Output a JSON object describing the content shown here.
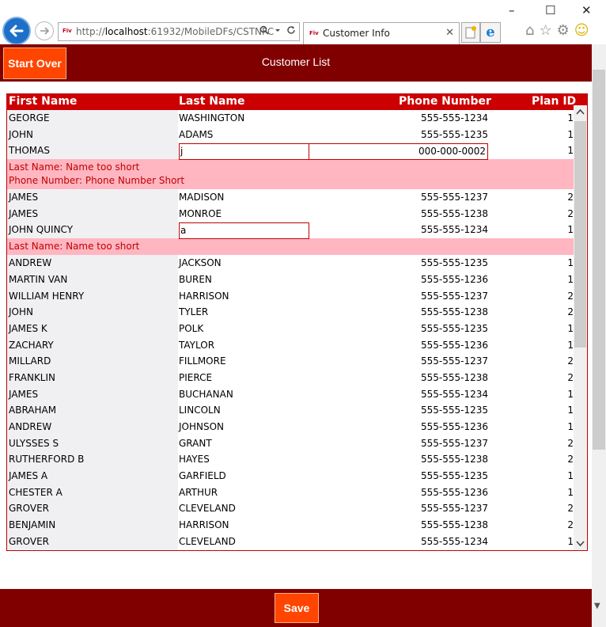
{
  "browser": {
    "address_prefix": "http://",
    "address_host": "localhost",
    "address_rest": ":61932/MobileDFs/CSTNFC",
    "tab_title": "Customer Info",
    "favicon_text": "Fiv",
    "window_controls": {
      "minimize": "–",
      "maximize": "☐",
      "close": "✕"
    },
    "tab_close": "✕"
  },
  "header": {
    "start_over_label": "Start Over",
    "title": "Customer List"
  },
  "grid": {
    "columns": {
      "first_name": "First Name",
      "last_name": "Last Name",
      "phone": "Phone Number",
      "plan": "Plan ID"
    },
    "rows": [
      {
        "first": "GEORGE",
        "last": "WASHINGTON",
        "phone": "555-555-1234",
        "plan": "1"
      },
      {
        "first": "JOHN",
        "last": "ADAMS",
        "phone": "555-555-1235",
        "plan": "1"
      },
      {
        "first": "THOMAS",
        "last": "j",
        "phone": "000-000-0002",
        "plan": "1",
        "editing": true,
        "errors": [
          "Last Name: Name too short",
          "Phone Number: Phone Number Short"
        ]
      },
      {
        "first": "JAMES",
        "last": "MADISON",
        "phone": "555-555-1237",
        "plan": "2"
      },
      {
        "first": "JAMES",
        "last": "MONROE",
        "phone": "555-555-1238",
        "plan": "2"
      },
      {
        "first": "JOHN QUINCY",
        "last": "a",
        "phone": "555-555-1234",
        "plan": "1",
        "editing_last": true,
        "errors": [
          "Last Name: Name too short"
        ]
      },
      {
        "first": "ANDREW",
        "last": "JACKSON",
        "phone": "555-555-1235",
        "plan": "1"
      },
      {
        "first": "MARTIN VAN",
        "last": "BUREN",
        "phone": "555-555-1236",
        "plan": "1"
      },
      {
        "first": "WILLIAM HENRY",
        "last": "HARRISON",
        "phone": "555-555-1237",
        "plan": "2"
      },
      {
        "first": "JOHN",
        "last": "TYLER",
        "phone": "555-555-1238",
        "plan": "2"
      },
      {
        "first": "JAMES K",
        "last": "POLK",
        "phone": "555-555-1235",
        "plan": "1"
      },
      {
        "first": "ZACHARY",
        "last": "TAYLOR",
        "phone": "555-555-1236",
        "plan": "1"
      },
      {
        "first": "MILLARD",
        "last": "FILLMORE",
        "phone": "555-555-1237",
        "plan": "2"
      },
      {
        "first": "FRANKLIN",
        "last": "PIERCE",
        "phone": "555-555-1238",
        "plan": "2"
      },
      {
        "first": "JAMES",
        "last": "BUCHANAN",
        "phone": "555-555-1234",
        "plan": "1"
      },
      {
        "first": "ABRAHAM",
        "last": "LINCOLN",
        "phone": "555-555-1235",
        "plan": "1"
      },
      {
        "first": "ANDREW",
        "last": "JOHNSON",
        "phone": "555-555-1236",
        "plan": "1"
      },
      {
        "first": "ULYSSES S",
        "last": "GRANT",
        "phone": "555-555-1237",
        "plan": "2"
      },
      {
        "first": "RUTHERFORD B",
        "last": "HAYES",
        "phone": "555-555-1238",
        "plan": "2"
      },
      {
        "first": "JAMES A",
        "last": "GARFIELD",
        "phone": "555-555-1235",
        "plan": "1"
      },
      {
        "first": "CHESTER A",
        "last": "ARTHUR",
        "phone": "555-555-1236",
        "plan": "1"
      },
      {
        "first": "GROVER",
        "last": "CLEVELAND",
        "phone": "555-555-1237",
        "plan": "2"
      },
      {
        "first": "BENJAMIN",
        "last": "HARRISON",
        "phone": "555-555-1238",
        "plan": "2"
      },
      {
        "first": "GROVER",
        "last": "CLEVELAND",
        "phone": "555-555-1234",
        "plan": "1"
      }
    ]
  },
  "footer": {
    "save_label": "Save"
  },
  "colors": {
    "header_bg": "#800000",
    "button_bg": "#ff4500",
    "grid_header_bg": "#cc0000",
    "error_bg": "#ffb6c1",
    "error_text": "#c00000"
  }
}
